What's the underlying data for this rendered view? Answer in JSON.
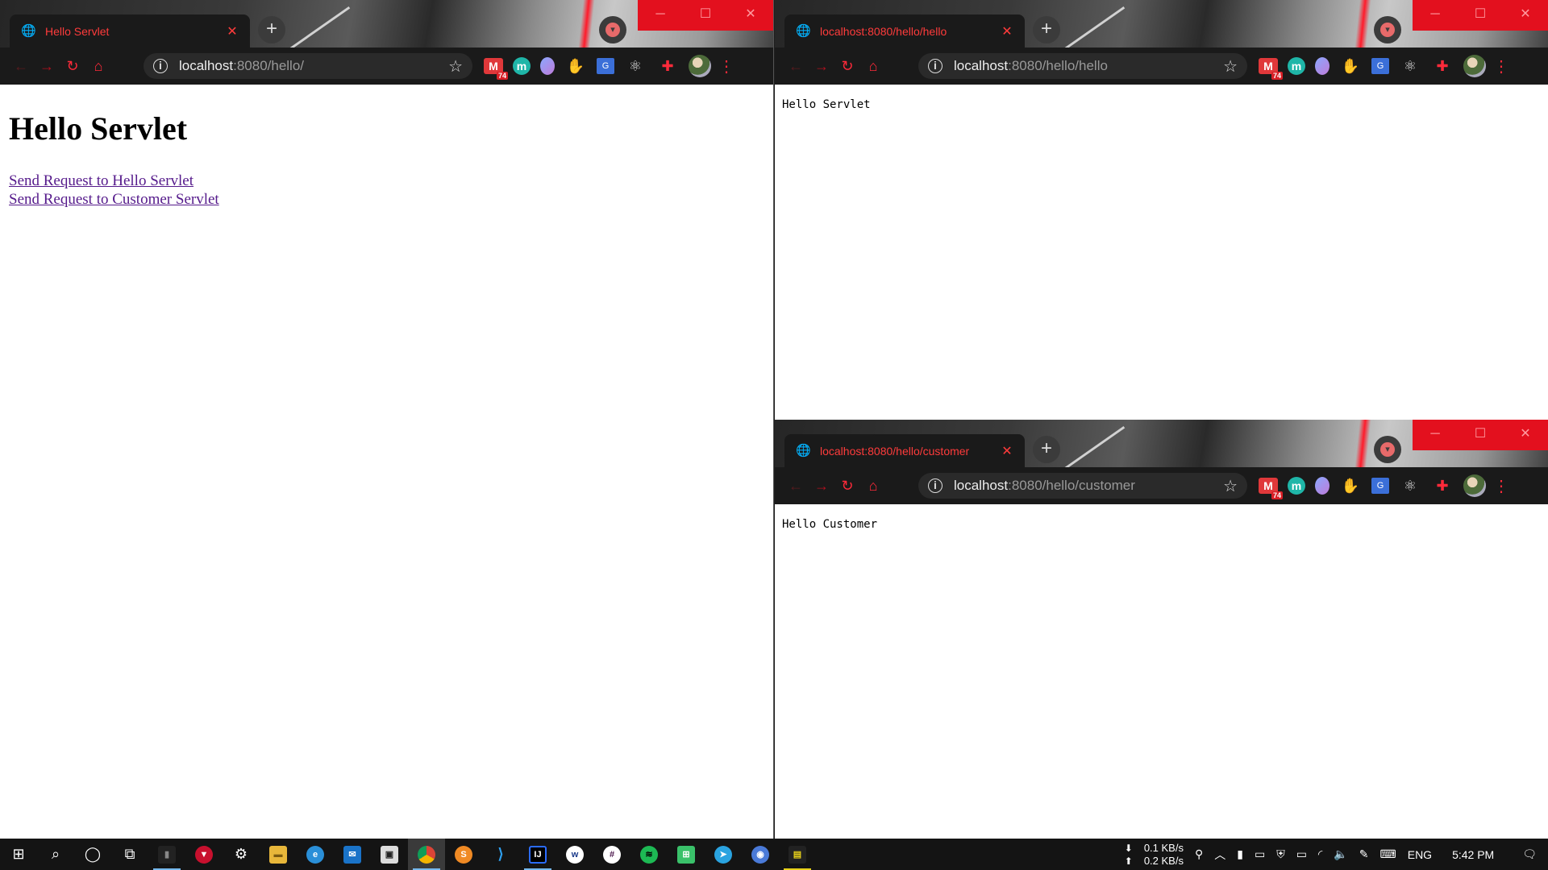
{
  "browser": {
    "accent": "#ff3b3b",
    "window_controls": [
      "─",
      "☐",
      "✕"
    ]
  },
  "windows": {
    "left": {
      "tab_title": "Hello Servlet",
      "url_host": "localhost",
      "url_rest": ":8080/hello/",
      "page": {
        "heading": "Hello Servlet",
        "links": [
          "Send Request to Hello Servlet",
          "Send Request to Customer Servlet"
        ]
      }
    },
    "top_right": {
      "tab_title": "localhost:8080/hello/hello",
      "url_host": "localhost",
      "url_rest": ":8080/hello/hello",
      "page": {
        "text": "Hello Servlet"
      }
    },
    "bottom_right": {
      "tab_title": "localhost:8080/hello/customer",
      "url_host": "localhost",
      "url_rest": ":8080/hello/customer",
      "page": {
        "text": "Hello Customer"
      }
    }
  },
  "extensions": {
    "gmail_badge": "74",
    "m_label": "m"
  },
  "taskbar": {
    "net_down": "0.1 KB/s",
    "net_up": "0.2 KB/s",
    "language": "ENG",
    "time": "5:42 PM"
  }
}
